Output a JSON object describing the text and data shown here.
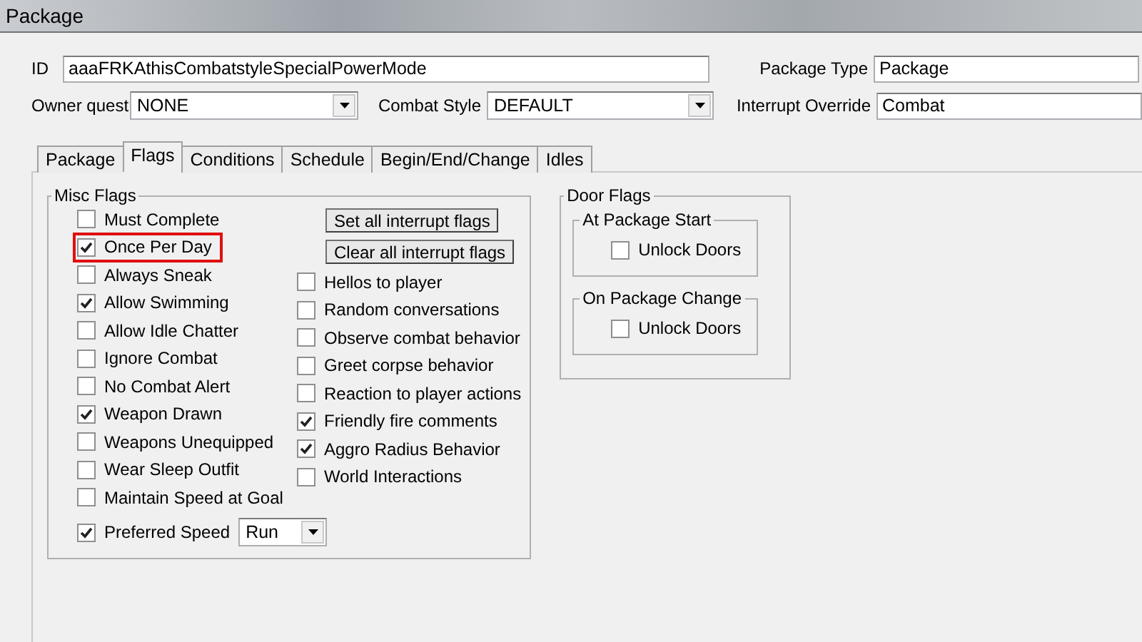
{
  "window": {
    "title": "Package"
  },
  "fields": {
    "id": {
      "label": "ID",
      "value": "aaaFRKAthisCombatstyleSpecialPowerMode"
    },
    "package_type": {
      "label": "Package Type",
      "value": "Package"
    },
    "owner_quest": {
      "label": "Owner quest",
      "value": "NONE"
    },
    "combat_style": {
      "label": "Combat Style",
      "value": "DEFAULT"
    },
    "interrupt_override": {
      "label": "Interrupt Override",
      "value": "Combat"
    }
  },
  "tabs": [
    {
      "label": "Package",
      "selected": false
    },
    {
      "label": "Flags",
      "selected": true
    },
    {
      "label": "Conditions",
      "selected": false
    },
    {
      "label": "Schedule",
      "selected": false
    },
    {
      "label": "Begin/End/Change",
      "selected": false
    },
    {
      "label": "Idles",
      "selected": false
    }
  ],
  "misc_flags": {
    "title": "Misc Flags",
    "left": [
      {
        "kind": "check",
        "label": "Must Complete",
        "checked": false,
        "highlighted": false
      },
      {
        "kind": "check",
        "label": "Once Per Day",
        "checked": true,
        "highlighted": true
      },
      {
        "kind": "check",
        "label": "Always Sneak",
        "checked": false,
        "highlighted": false
      },
      {
        "kind": "check",
        "label": "Allow Swimming",
        "checked": true,
        "highlighted": false
      },
      {
        "kind": "check",
        "label": "Allow Idle Chatter",
        "checked": false,
        "highlighted": false
      },
      {
        "kind": "check",
        "label": "Ignore Combat",
        "checked": false,
        "highlighted": false
      },
      {
        "kind": "check",
        "label": "No Combat Alert",
        "checked": false,
        "highlighted": false
      },
      {
        "kind": "check",
        "label": "Weapon Drawn",
        "checked": true,
        "highlighted": false
      },
      {
        "kind": "check",
        "label": "Weapons Unequipped",
        "checked": false,
        "highlighted": false
      },
      {
        "kind": "check",
        "label": "Wear Sleep Outfit",
        "checked": false,
        "highlighted": false
      },
      {
        "kind": "check",
        "label": "Maintain Speed at Goal",
        "checked": false,
        "highlighted": false
      },
      {
        "kind": "speed",
        "label": "Preferred Speed",
        "checked": true,
        "value": "Run"
      }
    ],
    "buttons": [
      "Set all interrupt flags",
      "Clear all interrupt flags"
    ],
    "right": [
      {
        "label": "Hellos to player",
        "checked": false
      },
      {
        "label": "Random conversations",
        "checked": false
      },
      {
        "label": "Observe combat behavior",
        "checked": false
      },
      {
        "label": "Greet corpse behavior",
        "checked": false
      },
      {
        "label": "Reaction to player actions",
        "checked": false
      },
      {
        "label": "Friendly fire comments",
        "checked": true
      },
      {
        "label": "Aggro Radius Behavior",
        "checked": true
      },
      {
        "label": "World Interactions",
        "checked": false
      }
    ]
  },
  "door_flags": {
    "title": "Door Flags",
    "groups": [
      {
        "title": "At Package Start",
        "label": "Unlock Doors",
        "checked": false
      },
      {
        "title": "On Package Change",
        "label": "Unlock Doors",
        "checked": false
      }
    ]
  }
}
